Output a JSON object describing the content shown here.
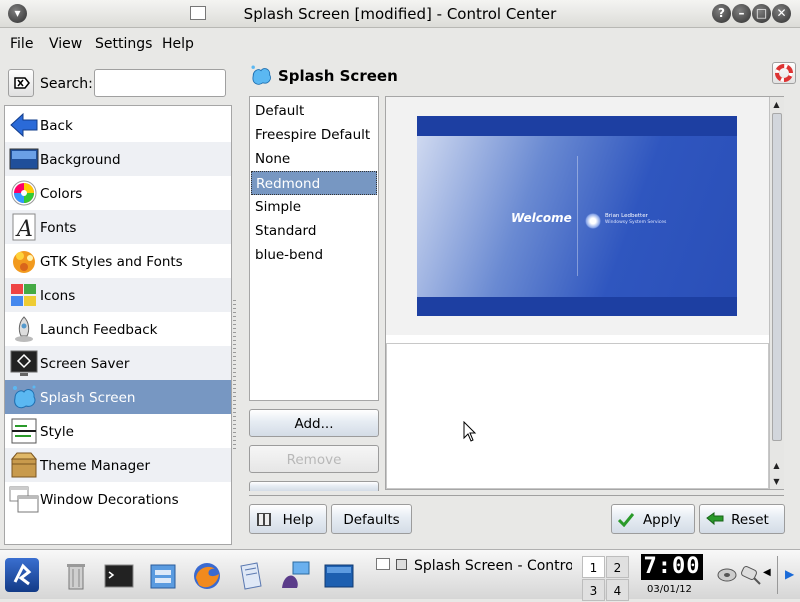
{
  "window": {
    "title": "Splash Screen [modified] - Control Center",
    "buttons": [
      "?",
      "–",
      "□",
      "✕"
    ]
  },
  "menubar": [
    "File",
    "View",
    "Settings",
    "Help"
  ],
  "search": {
    "label": "Search:",
    "value": "",
    "placeholder": ""
  },
  "modules": [
    {
      "label": "Back",
      "icon": "back-arrow-icon"
    },
    {
      "label": "Background",
      "icon": "background-icon"
    },
    {
      "label": "Colors",
      "icon": "colors-icon"
    },
    {
      "label": "Fonts",
      "icon": "fonts-icon"
    },
    {
      "label": "GTK Styles and Fonts",
      "icon": "gtk-icon"
    },
    {
      "label": "Icons",
      "icon": "icons-icon"
    },
    {
      "label": "Launch Feedback",
      "icon": "launch-feedback-icon"
    },
    {
      "label": "Screen Saver",
      "icon": "screen-saver-icon"
    },
    {
      "label": "Splash Screen",
      "icon": "splash-screen-icon",
      "selected": true
    },
    {
      "label": "Style",
      "icon": "style-icon"
    },
    {
      "label": "Theme Manager",
      "icon": "theme-manager-icon"
    },
    {
      "label": "Window Decorations",
      "icon": "window-decorations-icon"
    }
  ],
  "page": {
    "title": "Splash Screen"
  },
  "themes": {
    "items": [
      "Default",
      "Freespire Default",
      "None",
      "Redmond",
      "Simple",
      "Standard",
      "blue-bend"
    ],
    "selected": "Redmond"
  },
  "buttons": {
    "add": "Add...",
    "remove": "Remove",
    "help": "Help",
    "defaults": "Defaults",
    "apply": "Apply",
    "reset": "Reset"
  },
  "preview": {
    "welcome": "Welcome",
    "name": "Brian Ledbetter",
    "subtitle": "Windowsy System Services"
  },
  "taskbar": {
    "task_label": "Splash Screen - Contro",
    "pager": [
      "1",
      "2",
      "3",
      "4"
    ],
    "active_desktop": "1",
    "clock": "7:00",
    "date": "03/01/12"
  },
  "colors": {
    "selection": "#7797c2",
    "splash_blue": "#1d3fa2"
  }
}
